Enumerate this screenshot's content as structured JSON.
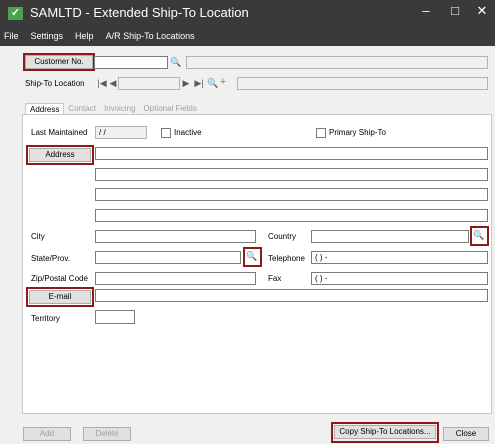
{
  "window": {
    "title": "SAMLTD - Extended Ship-To Location",
    "minimize": "–",
    "maximize": "□",
    "close": "✕"
  },
  "menu": {
    "file": "File",
    "settings": "Settings",
    "help": "Help",
    "ar": "A/R Ship-To Locations"
  },
  "header": {
    "customer_button": "Customer No.",
    "ship_to_label": "Ship-To Location"
  },
  "tabs": [
    "Address",
    "Contact",
    "Invoicing",
    "Optional Fields"
  ],
  "form": {
    "last_maintained_label": "Last Maintained",
    "last_maintained_value": "/  /",
    "inactive_label": "Inactive",
    "primary_label": "Primary Ship-To",
    "address_button": "Address",
    "city_label": "City",
    "state_label": "State/Prov.",
    "zip_label": "Zip/Postal Code",
    "email_button": "E-mail",
    "territory_label": "Territory",
    "country_label": "Country",
    "telephone_label": "Telephone",
    "telephone_value": "(    )    -",
    "fax_label": "Fax",
    "fax_value": "(    )    -"
  },
  "footer": {
    "add": "Add",
    "delete": "Delete",
    "copy": "Copy Ship-To Locations...",
    "close": "Close"
  }
}
